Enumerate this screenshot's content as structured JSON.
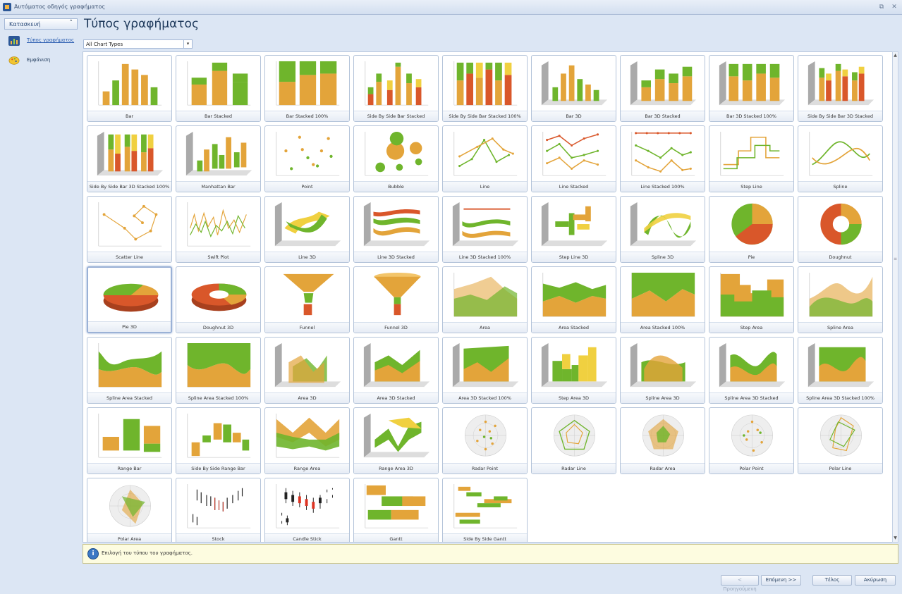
{
  "window": {
    "title": "Αυτόματος οδηγός γραφήματος",
    "restore_glyph": "⧉",
    "close_glyph": "✕"
  },
  "sidebar": {
    "category": "Κατασκευή",
    "collapse_glyph": "˄",
    "items": [
      {
        "label": "Τύπος γραφήματος",
        "icon": "bar-chart-icon",
        "active": true
      },
      {
        "label": "Εμφάνιση",
        "icon": "palette-icon",
        "active": false
      }
    ]
  },
  "main": {
    "title": "Τύπος γραφήματος",
    "filter": {
      "value": "All Chart Types",
      "arrow": "▾"
    }
  },
  "chart_types": [
    "Bar",
    "Bar Stacked",
    "Bar Stacked 100%",
    "Side By Side Bar Stacked",
    "Side By Side Bar Stacked 100%",
    "Bar 3D",
    "Bar 3D Stacked",
    "Bar 3D Stacked 100%",
    "Side By Side Bar 3D Stacked",
    "Side By Side Bar 3D Stacked 100%",
    "Manhattan Bar",
    "Point",
    "Bubble",
    "Line",
    "Line Stacked",
    "Line Stacked 100%",
    "Step Line",
    "Spline",
    "Scatter Line",
    "Swift Plot",
    "Line 3D",
    "Line 3D Stacked",
    "Line 3D Stacked 100%",
    "Step Line 3D",
    "Spline 3D",
    "Pie",
    "Doughnut",
    "Pie 3D",
    "Doughnut 3D",
    "Funnel",
    "Funnel 3D",
    "Area",
    "Area Stacked",
    "Area Stacked 100%",
    "Step Area",
    "Spline Area",
    "Spline Area Stacked",
    "Spline Area Stacked 100%",
    "Area 3D",
    "Area 3D Stacked",
    "Area 3D Stacked 100%",
    "Step Area 3D",
    "Spline Area 3D",
    "Spline Area 3D Stacked",
    "Spline Area 3D Stacked 100%",
    "Range Bar",
    "Side By Side Range Bar",
    "Range Area",
    "Range Area 3D",
    "Radar Point",
    "Radar Line",
    "Radar Area",
    "Polar Point",
    "Polar Line",
    "Polar Area",
    "Stock",
    "Candle Stick",
    "Gantt",
    "Side By Side Gantt"
  ],
  "selected_chart_type": "Pie 3D",
  "info": {
    "text": "Επιλογή του τύπου του γραφήματος.",
    "icon_glyph": "i"
  },
  "footer": {
    "prev": "< Προηγούμενη",
    "next": "Επόμενη >>",
    "finish": "Τέλος",
    "cancel": "Ακύρωση"
  },
  "scroll": {
    "up": "▲",
    "down": "▼",
    "grip": "≡"
  },
  "colors": {
    "green": "#6fb52c",
    "orange": "#e3a43a",
    "red": "#d9572a",
    "yellow": "#f0d040",
    "accent": "#2b5797"
  }
}
